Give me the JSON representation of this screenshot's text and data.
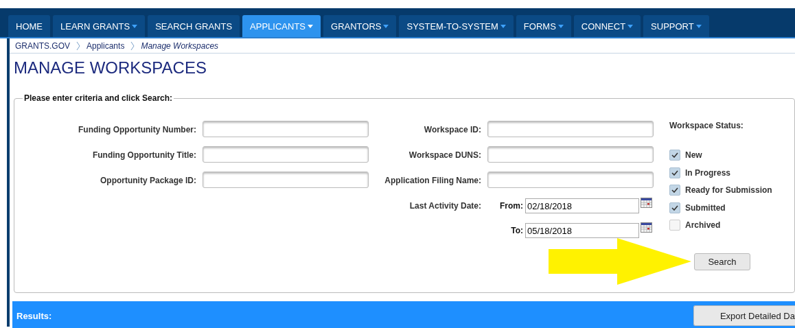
{
  "nav": [
    {
      "label": "HOME",
      "selected": false,
      "dropdown": false
    },
    {
      "label": "LEARN GRANTS",
      "selected": false,
      "dropdown": true
    },
    {
      "label": "SEARCH GRANTS",
      "selected": false,
      "dropdown": false
    },
    {
      "label": "APPLICANTS",
      "selected": true,
      "dropdown": true
    },
    {
      "label": "GRANTORS",
      "selected": false,
      "dropdown": true
    },
    {
      "label": "SYSTEM-TO-SYSTEM",
      "selected": false,
      "dropdown": true
    },
    {
      "label": "FORMS",
      "selected": false,
      "dropdown": true
    },
    {
      "label": "CONNECT",
      "selected": false,
      "dropdown": true
    },
    {
      "label": "SUPPORT",
      "selected": false,
      "dropdown": true
    }
  ],
  "breadcrumb": [
    {
      "label": "GRANTS.GOV",
      "current": false
    },
    {
      "label": "Applicants",
      "current": false
    },
    {
      "label": "Manage Workspaces",
      "current": true
    }
  ],
  "title": "MANAGE WORKSPACES",
  "criteria": {
    "legend": "Please enter criteria and click Search:",
    "left_fields": [
      {
        "label": "Funding Opportunity Number:"
      },
      {
        "label": "Funding Opportunity Title:"
      },
      {
        "label": "Opportunity Package ID:"
      }
    ],
    "middle_fields": [
      {
        "label": "Workspace ID:"
      },
      {
        "label": "Workspace DUNS:"
      },
      {
        "label": "Application Filing Name:"
      }
    ],
    "last_activity": {
      "label": "Last Activity Date:",
      "from_label": "From:",
      "from_value": "02/18/2018",
      "to_label": "To:",
      "to_value": "05/18/2018"
    },
    "status": {
      "label": "Workspace Status:",
      "options": [
        {
          "label": "New",
          "checked": true
        },
        {
          "label": "In Progress",
          "checked": true
        },
        {
          "label": "Ready for Submission",
          "checked": true
        },
        {
          "label": "Submitted",
          "checked": true
        },
        {
          "label": "Archived",
          "checked": false
        }
      ]
    },
    "search_button": "Search"
  },
  "results": {
    "label": "Results:",
    "export_button": "Export Detailed Da"
  }
}
